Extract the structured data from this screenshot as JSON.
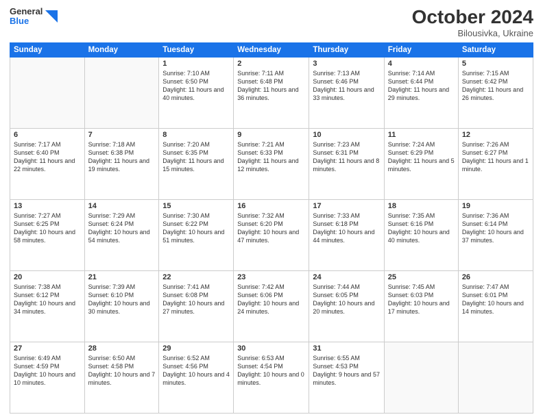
{
  "header": {
    "logo_general": "General",
    "logo_blue": "Blue",
    "title": "October 2024",
    "location": "Bilousivka, Ukraine"
  },
  "weekdays": [
    "Sunday",
    "Monday",
    "Tuesday",
    "Wednesday",
    "Thursday",
    "Friday",
    "Saturday"
  ],
  "weeks": [
    [
      {
        "day": "",
        "detail": ""
      },
      {
        "day": "",
        "detail": ""
      },
      {
        "day": "1",
        "detail": "Sunrise: 7:10 AM\nSunset: 6:50 PM\nDaylight: 11 hours and 40 minutes."
      },
      {
        "day": "2",
        "detail": "Sunrise: 7:11 AM\nSunset: 6:48 PM\nDaylight: 11 hours and 36 minutes."
      },
      {
        "day": "3",
        "detail": "Sunrise: 7:13 AM\nSunset: 6:46 PM\nDaylight: 11 hours and 33 minutes."
      },
      {
        "day": "4",
        "detail": "Sunrise: 7:14 AM\nSunset: 6:44 PM\nDaylight: 11 hours and 29 minutes."
      },
      {
        "day": "5",
        "detail": "Sunrise: 7:15 AM\nSunset: 6:42 PM\nDaylight: 11 hours and 26 minutes."
      }
    ],
    [
      {
        "day": "6",
        "detail": "Sunrise: 7:17 AM\nSunset: 6:40 PM\nDaylight: 11 hours and 22 minutes."
      },
      {
        "day": "7",
        "detail": "Sunrise: 7:18 AM\nSunset: 6:38 PM\nDaylight: 11 hours and 19 minutes."
      },
      {
        "day": "8",
        "detail": "Sunrise: 7:20 AM\nSunset: 6:35 PM\nDaylight: 11 hours and 15 minutes."
      },
      {
        "day": "9",
        "detail": "Sunrise: 7:21 AM\nSunset: 6:33 PM\nDaylight: 11 hours and 12 minutes."
      },
      {
        "day": "10",
        "detail": "Sunrise: 7:23 AM\nSunset: 6:31 PM\nDaylight: 11 hours and 8 minutes."
      },
      {
        "day": "11",
        "detail": "Sunrise: 7:24 AM\nSunset: 6:29 PM\nDaylight: 11 hours and 5 minutes."
      },
      {
        "day": "12",
        "detail": "Sunrise: 7:26 AM\nSunset: 6:27 PM\nDaylight: 11 hours and 1 minute."
      }
    ],
    [
      {
        "day": "13",
        "detail": "Sunrise: 7:27 AM\nSunset: 6:25 PM\nDaylight: 10 hours and 58 minutes."
      },
      {
        "day": "14",
        "detail": "Sunrise: 7:29 AM\nSunset: 6:24 PM\nDaylight: 10 hours and 54 minutes."
      },
      {
        "day": "15",
        "detail": "Sunrise: 7:30 AM\nSunset: 6:22 PM\nDaylight: 10 hours and 51 minutes."
      },
      {
        "day": "16",
        "detail": "Sunrise: 7:32 AM\nSunset: 6:20 PM\nDaylight: 10 hours and 47 minutes."
      },
      {
        "day": "17",
        "detail": "Sunrise: 7:33 AM\nSunset: 6:18 PM\nDaylight: 10 hours and 44 minutes."
      },
      {
        "day": "18",
        "detail": "Sunrise: 7:35 AM\nSunset: 6:16 PM\nDaylight: 10 hours and 40 minutes."
      },
      {
        "day": "19",
        "detail": "Sunrise: 7:36 AM\nSunset: 6:14 PM\nDaylight: 10 hours and 37 minutes."
      }
    ],
    [
      {
        "day": "20",
        "detail": "Sunrise: 7:38 AM\nSunset: 6:12 PM\nDaylight: 10 hours and 34 minutes."
      },
      {
        "day": "21",
        "detail": "Sunrise: 7:39 AM\nSunset: 6:10 PM\nDaylight: 10 hours and 30 minutes."
      },
      {
        "day": "22",
        "detail": "Sunrise: 7:41 AM\nSunset: 6:08 PM\nDaylight: 10 hours and 27 minutes."
      },
      {
        "day": "23",
        "detail": "Sunrise: 7:42 AM\nSunset: 6:06 PM\nDaylight: 10 hours and 24 minutes."
      },
      {
        "day": "24",
        "detail": "Sunrise: 7:44 AM\nSunset: 6:05 PM\nDaylight: 10 hours and 20 minutes."
      },
      {
        "day": "25",
        "detail": "Sunrise: 7:45 AM\nSunset: 6:03 PM\nDaylight: 10 hours and 17 minutes."
      },
      {
        "day": "26",
        "detail": "Sunrise: 7:47 AM\nSunset: 6:01 PM\nDaylight: 10 hours and 14 minutes."
      }
    ],
    [
      {
        "day": "27",
        "detail": "Sunrise: 6:49 AM\nSunset: 4:59 PM\nDaylight: 10 hours and 10 minutes."
      },
      {
        "day": "28",
        "detail": "Sunrise: 6:50 AM\nSunset: 4:58 PM\nDaylight: 10 hours and 7 minutes."
      },
      {
        "day": "29",
        "detail": "Sunrise: 6:52 AM\nSunset: 4:56 PM\nDaylight: 10 hours and 4 minutes."
      },
      {
        "day": "30",
        "detail": "Sunrise: 6:53 AM\nSunset: 4:54 PM\nDaylight: 10 hours and 0 minutes."
      },
      {
        "day": "31",
        "detail": "Sunrise: 6:55 AM\nSunset: 4:53 PM\nDaylight: 9 hours and 57 minutes."
      },
      {
        "day": "",
        "detail": ""
      },
      {
        "day": "",
        "detail": ""
      }
    ]
  ]
}
